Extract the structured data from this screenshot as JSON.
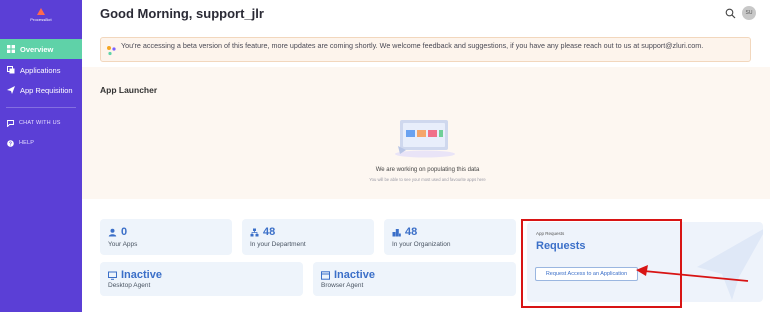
{
  "sidebar": {
    "logo_text": "ProcessBot",
    "items": [
      {
        "label": "Overview",
        "icon": "grid-icon"
      },
      {
        "label": "Applications",
        "icon": "apps-icon"
      },
      {
        "label": "App Requisition",
        "icon": "paper-plane-icon"
      }
    ],
    "secondary": [
      {
        "label": "CHAT WITH US",
        "icon": "chat-icon"
      },
      {
        "label": "HELP",
        "icon": "help-icon"
      }
    ],
    "active_color": "#5fd2a8",
    "bg_color": "#5b3fd6"
  },
  "header": {
    "greeting": "Good Morning, support_jlr",
    "avatar_initials": "SU"
  },
  "banner": {
    "text": "You're accessing a beta version of this feature, more updates are coming shortly. We welcome feedback and suggestions, if you have any please reach out to us at support@zluri.com."
  },
  "launcher": {
    "title": "App Launcher",
    "empty_title": "We are working on populating this data",
    "empty_subtitle": "You will be able to see your most used and favourite apps here"
  },
  "stats": [
    {
      "value": "0",
      "label": "Your Apps",
      "icon": "user-icon"
    },
    {
      "value": "48",
      "label": "In your Department",
      "icon": "department-icon"
    },
    {
      "value": "48",
      "label": "In your Organization",
      "icon": "organization-icon"
    }
  ],
  "agents": [
    {
      "value": "Inactive",
      "label": "Desktop Agent",
      "icon": "desktop-icon"
    },
    {
      "value": "Inactive",
      "label": "Browser Agent",
      "icon": "browser-icon"
    }
  ],
  "requests": {
    "small_label": "App Requests",
    "title": "Requests",
    "button_label": "Request Access to an Application"
  },
  "colors": {
    "accent_blue": "#3b6fc8",
    "highlight_red": "#d81414"
  }
}
